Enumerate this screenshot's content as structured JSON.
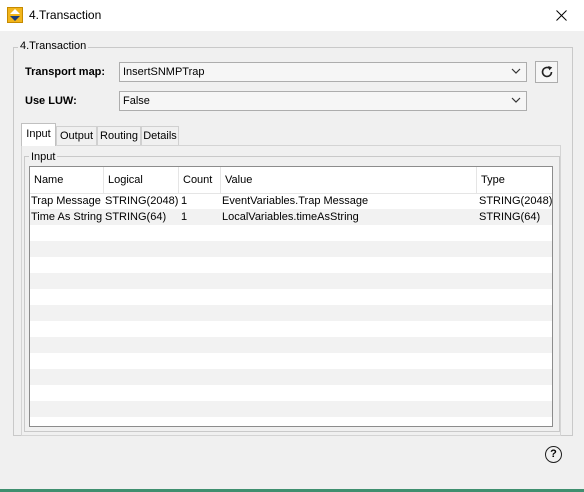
{
  "window": {
    "title": "4.Transaction",
    "app_icon": "up-down-arrows-icon",
    "close_icon": "close-icon"
  },
  "group": {
    "legend": "4.Transaction"
  },
  "transport_map": {
    "label": "Transport map:",
    "value": "InsertSNMPTrap"
  },
  "use_luw": {
    "label": "Use LUW:",
    "value": "False"
  },
  "tabs": [
    {
      "label": "Input",
      "active": true
    },
    {
      "label": "Output",
      "active": false
    },
    {
      "label": "Routing",
      "active": false
    },
    {
      "label": "Details",
      "active": false
    }
  ],
  "input_group": {
    "legend": "Input"
  },
  "table": {
    "columns": [
      "Name",
      "Logical",
      "Count",
      "Value",
      "Type"
    ],
    "rows": [
      [
        "Trap Message",
        "STRING(2048)",
        "1",
        "EventVariables.Trap Message",
        "STRING(2048)"
      ],
      [
        "Time As String",
        "STRING(64)",
        "1",
        "LocalVariables.timeAsString",
        "STRING(64)"
      ]
    ]
  },
  "colors": {
    "accent": "#f2b51b",
    "window_bg": "#f0f0f0",
    "stripe": "#f2f2f2",
    "bottom_bar": "#3f8f6f"
  },
  "help": {
    "label": "?"
  }
}
